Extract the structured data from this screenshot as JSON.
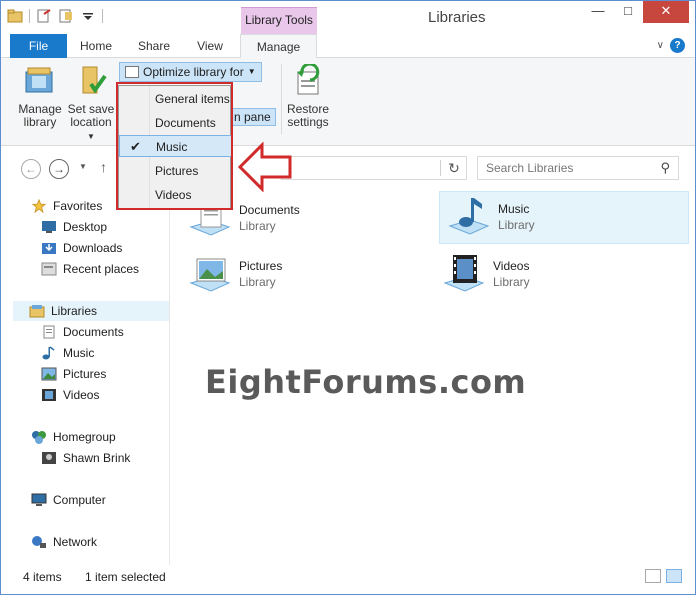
{
  "window": {
    "title": "Libraries",
    "contextual_tab": "Library Tools",
    "caption_buttons": [
      "minimize",
      "maximize",
      "close"
    ]
  },
  "tabs": [
    "File",
    "Home",
    "Share",
    "View",
    "Manage"
  ],
  "ribbon": {
    "manage_library": [
      "Manage",
      "library"
    ],
    "set_save_location": [
      "Set save",
      "location"
    ],
    "optimize_label": "Optimize library for",
    "show_nav_pane_partial": "n pane",
    "restore_settings": [
      "Restore",
      "settings"
    ]
  },
  "optimize_menu": {
    "items": [
      "General items",
      "Documents",
      "Music",
      "Pictures",
      "Videos"
    ],
    "selected": "Music"
  },
  "search": {
    "placeholder": "Search Libraries"
  },
  "nav_pane": {
    "favorites": {
      "label": "Favorites",
      "items": [
        "Desktop",
        "Downloads",
        "Recent places"
      ]
    },
    "libraries": {
      "label": "Libraries",
      "items": [
        "Documents",
        "Music",
        "Pictures",
        "Videos"
      ]
    },
    "homegroup": {
      "label": "Homegroup",
      "items": [
        "Shawn Brink"
      ]
    },
    "computer": "Computer",
    "network": "Network"
  },
  "libraries": [
    {
      "name": "Documents",
      "type": "Library",
      "icon": "documents-library-icon"
    },
    {
      "name": "Music",
      "type": "Library",
      "icon": "music-library-icon",
      "selected": true
    },
    {
      "name": "Pictures",
      "type": "Library",
      "icon": "pictures-library-icon"
    },
    {
      "name": "Videos",
      "type": "Library",
      "icon": "videos-library-icon"
    }
  ],
  "watermark": "EightForums.com",
  "status": {
    "items_count": "4 items",
    "selection": "1 item selected"
  },
  "colors": {
    "accent": "#1979ca",
    "contextual_tab": "#e8c7ea",
    "callout_red": "#d12a2a",
    "close": "#c7473f"
  }
}
